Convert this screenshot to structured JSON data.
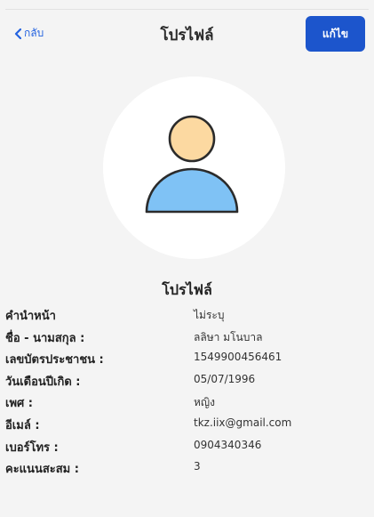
{
  "nav": {
    "back_label": "กลับ",
    "title": "โปรไฟล์",
    "edit_label": "แก้ไข"
  },
  "colors": {
    "accent": "#1c55cc",
    "back_link": "#2463e0",
    "avatar_head": "#fcd9a1",
    "avatar_body": "#7fc2f5",
    "avatar_outline": "#2b2b2b"
  },
  "avatar": {
    "icon": "user-avatar-icon"
  },
  "profile": {
    "title": "โปรไฟล์",
    "rows": [
      {
        "label": "คำนำหน้า",
        "value": "ไม่ระบุ"
      },
      {
        "label": "ชื่อ - นามสกุล :",
        "value": "ลลิษา มโนบาล"
      },
      {
        "label": "เลขบัตรประชาชน :",
        "value": "1549900456461"
      },
      {
        "label": "วันเดือนปีเกิด :",
        "value": "05/07/1996"
      },
      {
        "label": "เพศ :",
        "value": "หญิง"
      },
      {
        "label": "อีเมล์ :",
        "value": "tkz.iix@gmail.com"
      },
      {
        "label": "เบอร์โทร :",
        "value": "0904340346"
      },
      {
        "label": "คะแนนสะสม :",
        "value": "3"
      }
    ]
  }
}
